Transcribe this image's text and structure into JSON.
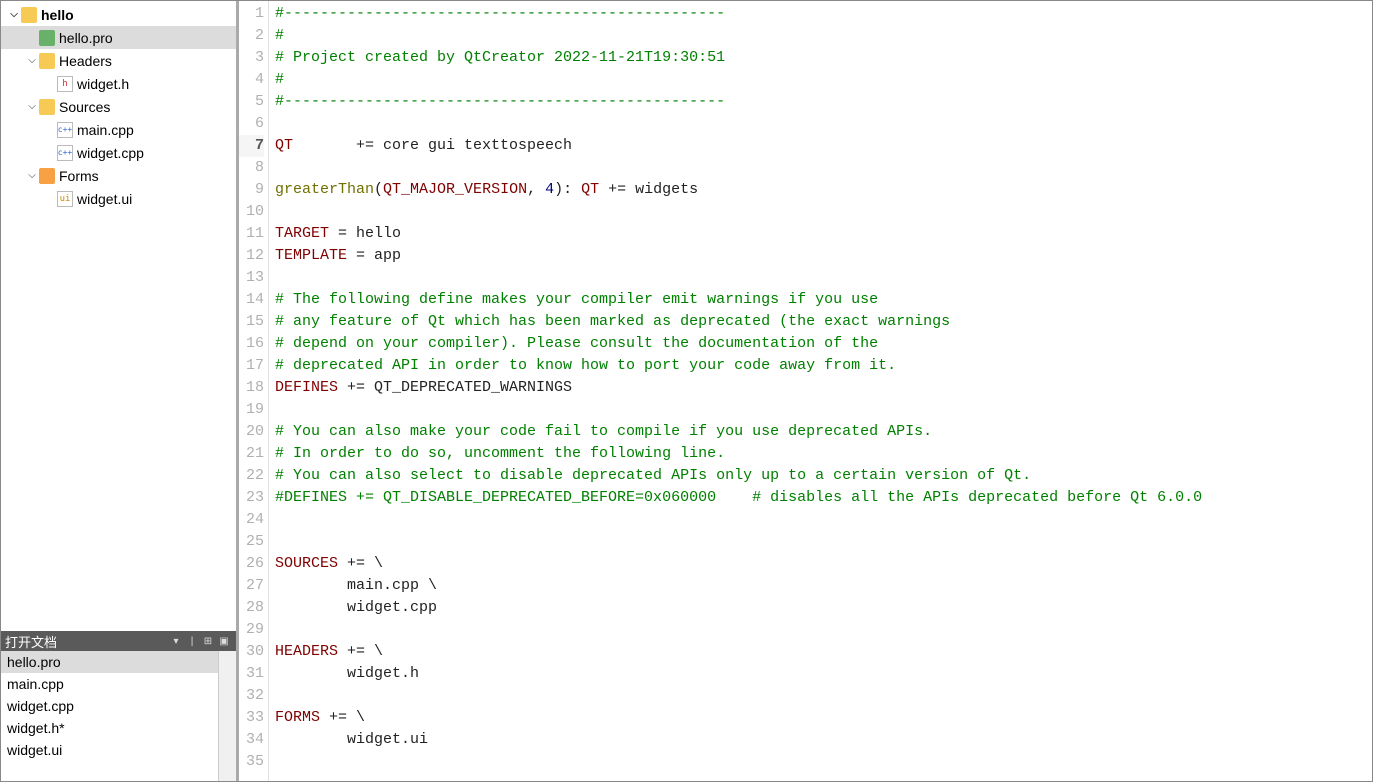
{
  "project_tree": {
    "root": {
      "name": "hello",
      "expanded": true
    },
    "root_file": "hello.pro",
    "groups": [
      {
        "name": "Headers",
        "icon": "folder",
        "expanded": true,
        "children": [
          {
            "name": "widget.h",
            "icon": "file-h"
          }
        ]
      },
      {
        "name": "Sources",
        "icon": "folder sources",
        "expanded": true,
        "children": [
          {
            "name": "main.cpp",
            "icon": "file-cpp"
          },
          {
            "name": "widget.cpp",
            "icon": "file-cpp"
          }
        ]
      },
      {
        "name": "Forms",
        "icon": "forms",
        "expanded": true,
        "children": [
          {
            "name": "widget.ui",
            "icon": "file-ui"
          }
        ]
      }
    ]
  },
  "open_docs": {
    "title": "打开文档",
    "items": [
      {
        "name": "hello.pro",
        "selected": true
      },
      {
        "name": "main.cpp"
      },
      {
        "name": "widget.cpp"
      },
      {
        "name": "widget.h*"
      },
      {
        "name": "widget.ui"
      }
    ]
  },
  "editor": {
    "current_line": 7,
    "lines": [
      {
        "n": 1,
        "tokens": [
          {
            "c": "tok-comment",
            "t": "#-------------------------------------------------"
          }
        ]
      },
      {
        "n": 2,
        "tokens": [
          {
            "c": "tok-comment",
            "t": "#"
          }
        ]
      },
      {
        "n": 3,
        "tokens": [
          {
            "c": "tok-comment",
            "t": "# Project created by QtCreator 2022-11-21T19:30:51"
          }
        ]
      },
      {
        "n": 4,
        "tokens": [
          {
            "c": "tok-comment",
            "t": "#"
          }
        ]
      },
      {
        "n": 5,
        "tokens": [
          {
            "c": "tok-comment",
            "t": "#-------------------------------------------------"
          }
        ]
      },
      {
        "n": 6,
        "tokens": []
      },
      {
        "n": 7,
        "tokens": [
          {
            "c": "tok-var",
            "t": "QT"
          },
          {
            "c": "tok-plain",
            "t": "       += core gui texttospeech"
          }
        ]
      },
      {
        "n": 8,
        "tokens": []
      },
      {
        "n": 9,
        "tokens": [
          {
            "c": "tok-func",
            "t": "greaterThan"
          },
          {
            "c": "tok-plain",
            "t": "("
          },
          {
            "c": "tok-var",
            "t": "QT_MAJOR_VERSION"
          },
          {
            "c": "tok-plain",
            "t": ", "
          },
          {
            "c": "tok-num",
            "t": "4"
          },
          {
            "c": "tok-plain",
            "t": "): "
          },
          {
            "c": "tok-var",
            "t": "QT"
          },
          {
            "c": "tok-plain",
            "t": " += widgets"
          }
        ]
      },
      {
        "n": 10,
        "tokens": []
      },
      {
        "n": 11,
        "tokens": [
          {
            "c": "tok-var",
            "t": "TARGET"
          },
          {
            "c": "tok-plain",
            "t": " = hello"
          }
        ]
      },
      {
        "n": 12,
        "tokens": [
          {
            "c": "tok-var",
            "t": "TEMPLATE"
          },
          {
            "c": "tok-plain",
            "t": " = app"
          }
        ]
      },
      {
        "n": 13,
        "tokens": []
      },
      {
        "n": 14,
        "tokens": [
          {
            "c": "tok-comment",
            "t": "# The following define makes your compiler emit warnings if you use"
          }
        ]
      },
      {
        "n": 15,
        "tokens": [
          {
            "c": "tok-comment",
            "t": "# any feature of Qt which has been marked as deprecated (the exact warnings"
          }
        ]
      },
      {
        "n": 16,
        "tokens": [
          {
            "c": "tok-comment",
            "t": "# depend on your compiler). Please consult the documentation of the"
          }
        ]
      },
      {
        "n": 17,
        "tokens": [
          {
            "c": "tok-comment",
            "t": "# deprecated API in order to know how to port your code away from it."
          }
        ]
      },
      {
        "n": 18,
        "tokens": [
          {
            "c": "tok-var",
            "t": "DEFINES"
          },
          {
            "c": "tok-plain",
            "t": " += QT_DEPRECATED_WARNINGS"
          }
        ]
      },
      {
        "n": 19,
        "tokens": []
      },
      {
        "n": 20,
        "tokens": [
          {
            "c": "tok-comment",
            "t": "# You can also make your code fail to compile if you use deprecated APIs."
          }
        ]
      },
      {
        "n": 21,
        "tokens": [
          {
            "c": "tok-comment",
            "t": "# In order to do so, uncomment the following line."
          }
        ]
      },
      {
        "n": 22,
        "tokens": [
          {
            "c": "tok-comment",
            "t": "# You can also select to disable deprecated APIs only up to a certain version of Qt."
          }
        ]
      },
      {
        "n": 23,
        "tokens": [
          {
            "c": "tok-comment",
            "t": "#DEFINES += QT_DISABLE_DEPRECATED_BEFORE=0x060000    # disables all the APIs deprecated before Qt 6.0.0"
          }
        ]
      },
      {
        "n": 24,
        "tokens": []
      },
      {
        "n": 25,
        "tokens": []
      },
      {
        "n": 26,
        "tokens": [
          {
            "c": "tok-var",
            "t": "SOURCES"
          },
          {
            "c": "tok-plain",
            "t": " += \\"
          }
        ]
      },
      {
        "n": 27,
        "tokens": [
          {
            "c": "tok-plain",
            "t": "        main.cpp \\"
          }
        ]
      },
      {
        "n": 28,
        "tokens": [
          {
            "c": "tok-plain",
            "t": "        widget.cpp"
          }
        ]
      },
      {
        "n": 29,
        "tokens": []
      },
      {
        "n": 30,
        "tokens": [
          {
            "c": "tok-var",
            "t": "HEADERS"
          },
          {
            "c": "tok-plain",
            "t": " += \\"
          }
        ]
      },
      {
        "n": 31,
        "tokens": [
          {
            "c": "tok-plain",
            "t": "        widget.h"
          }
        ]
      },
      {
        "n": 32,
        "tokens": []
      },
      {
        "n": 33,
        "tokens": [
          {
            "c": "tok-var",
            "t": "FORMS"
          },
          {
            "c": "tok-plain",
            "t": " += \\"
          }
        ]
      },
      {
        "n": 34,
        "tokens": [
          {
            "c": "tok-plain",
            "t": "        widget.ui"
          }
        ]
      },
      {
        "n": 35,
        "tokens": []
      }
    ]
  }
}
